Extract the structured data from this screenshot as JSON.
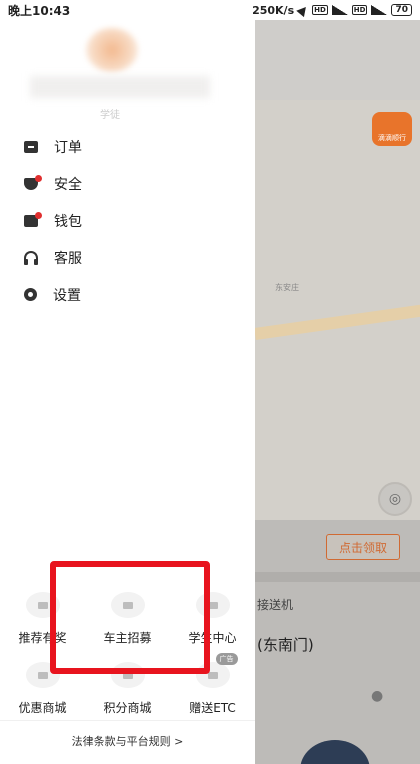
{
  "status_bar": {
    "time": "晚上10:43",
    "net_speed": "250K/s",
    "hd1": "HD",
    "hd2": "HD",
    "battery": "70"
  },
  "drawer": {
    "profile_tag": "学徒",
    "menu": [
      {
        "label": "订单",
        "icon": "order-icon",
        "badge": false
      },
      {
        "label": "安全",
        "icon": "shield-icon",
        "badge": true
      },
      {
        "label": "钱包",
        "icon": "wallet-icon",
        "badge": true
      },
      {
        "label": "客服",
        "icon": "headset-icon",
        "badge": false
      },
      {
        "label": "设置",
        "icon": "gear-icon",
        "badge": false
      }
    ],
    "grid": [
      {
        "label": "推荐有奖",
        "icon": "gift-icon"
      },
      {
        "label": "车主招募",
        "icon": "car-icon"
      },
      {
        "label": "学生中心",
        "icon": "student-icon"
      },
      {
        "label": "优惠商城",
        "icon": "shop-icon"
      },
      {
        "label": "积分商城",
        "icon": "points-icon"
      },
      {
        "label": "赠送ETC",
        "icon": "etc-icon",
        "ad_tag": "广告"
      }
    ],
    "footer_link": "法律条款与平台规则 >"
  },
  "map": {
    "badge": "滴滴顺行",
    "place_label": "东安庄"
  },
  "right_panel": {
    "claim_button": "点击领取",
    "pickup_text": "接送机",
    "place_text": "(东南门)"
  },
  "colors": {
    "highlight": "#e8141e",
    "accent": "#d06a33",
    "badge_red": "#e02f2f"
  }
}
